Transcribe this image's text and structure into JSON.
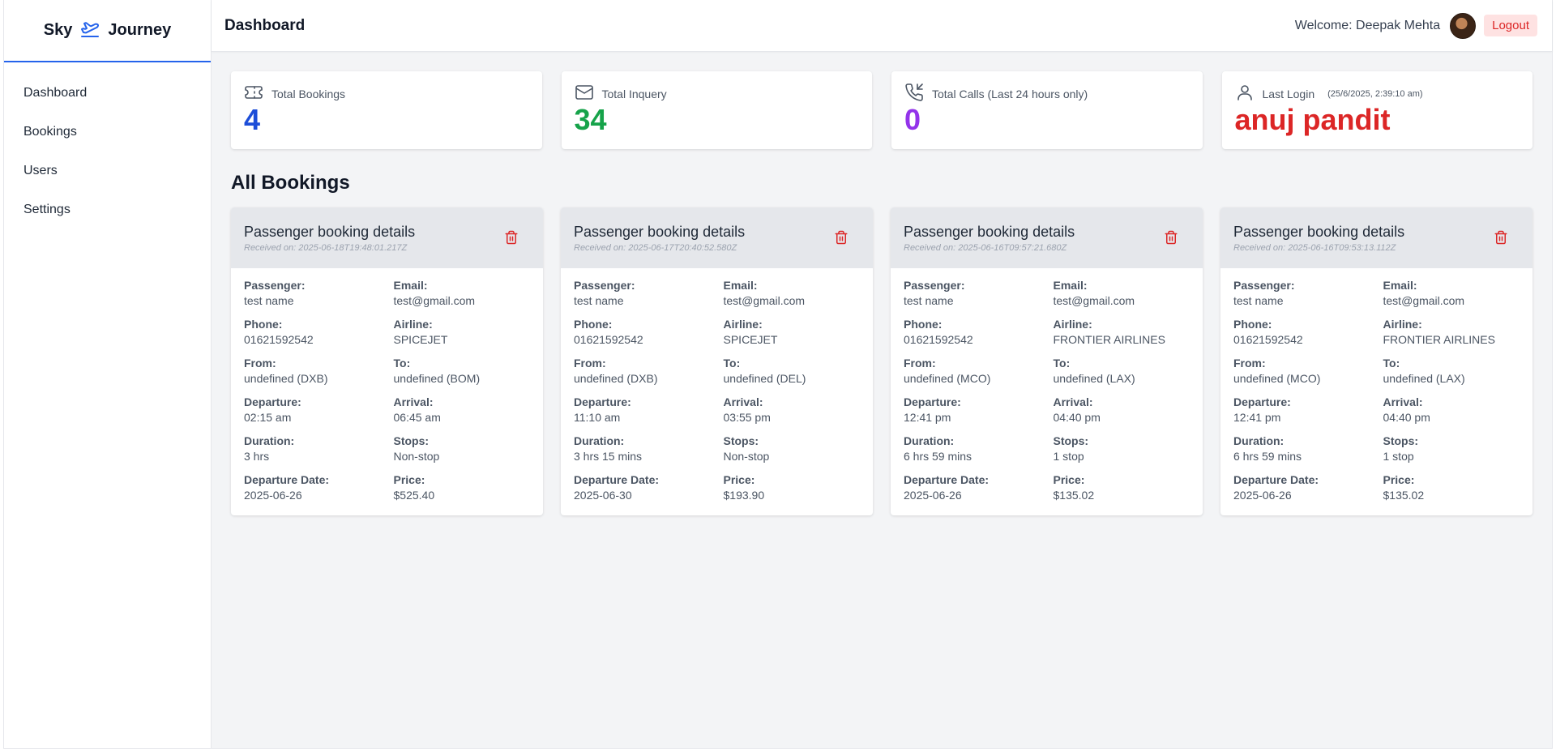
{
  "app": {
    "brand_left": "Sky",
    "brand_right": "Journey"
  },
  "sidebar": {
    "items": [
      {
        "label": "Dashboard"
      },
      {
        "label": "Bookings"
      },
      {
        "label": "Users"
      },
      {
        "label": "Settings"
      }
    ]
  },
  "header": {
    "title": "Dashboard",
    "welcome": "Welcome: Deepak Mehta",
    "logout": "Logout"
  },
  "stats": [
    {
      "label": "Total Bookings",
      "value": "4",
      "color": "#1d4ed8",
      "icon": "ticket-icon"
    },
    {
      "label": "Total Inquery",
      "value": "34",
      "color": "#16a34a",
      "icon": "mail-icon"
    },
    {
      "label": "Total Calls (Last 24 hours only)",
      "value": "0",
      "color": "#9333ea",
      "icon": "phone-incoming-icon"
    },
    {
      "label": "Last Login",
      "sub": "(25/6/2025, 2:39:10 am)",
      "value": "anuj pandit",
      "color": "#dc2626",
      "icon": "user-icon"
    }
  ],
  "bookings_title": "All Bookings",
  "bookings": [
    {
      "title": "Passenger booking details",
      "received": "Received on: 2025-06-18T19:48:01.217Z",
      "fields": [
        {
          "label": "Passenger:",
          "value": "test name"
        },
        {
          "label": "Email:",
          "value": "test@gmail.com"
        },
        {
          "label": "Phone:",
          "value": "01621592542"
        },
        {
          "label": "Airline:",
          "value": "SPICEJET"
        },
        {
          "label": "From:",
          "value": "undefined (DXB)"
        },
        {
          "label": "To:",
          "value": "undefined (BOM)"
        },
        {
          "label": "Departure:",
          "value": "02:15 am"
        },
        {
          "label": "Arrival:",
          "value": "06:45 am"
        },
        {
          "label": "Duration:",
          "value": "3 hrs"
        },
        {
          "label": "Stops:",
          "value": "Non-stop"
        },
        {
          "label": "Departure Date:",
          "value": "2025-06-26"
        },
        {
          "label": "Price:",
          "value": "$525.40"
        }
      ]
    },
    {
      "title": "Passenger booking details",
      "received": "Received on: 2025-06-17T20:40:52.580Z",
      "fields": [
        {
          "label": "Passenger:",
          "value": "test name"
        },
        {
          "label": "Email:",
          "value": "test@gmail.com"
        },
        {
          "label": "Phone:",
          "value": "01621592542"
        },
        {
          "label": "Airline:",
          "value": "SPICEJET"
        },
        {
          "label": "From:",
          "value": "undefined (DXB)"
        },
        {
          "label": "To:",
          "value": "undefined (DEL)"
        },
        {
          "label": "Departure:",
          "value": "11:10 am"
        },
        {
          "label": "Arrival:",
          "value": "03:55 pm"
        },
        {
          "label": "Duration:",
          "value": "3 hrs 15 mins"
        },
        {
          "label": "Stops:",
          "value": "Non-stop"
        },
        {
          "label": "Departure Date:",
          "value": "2025-06-30"
        },
        {
          "label": "Price:",
          "value": "$193.90"
        }
      ]
    },
    {
      "title": "Passenger booking details",
      "received": "Received on: 2025-06-16T09:57:21.680Z",
      "fields": [
        {
          "label": "Passenger:",
          "value": "test name"
        },
        {
          "label": "Email:",
          "value": "test@gmail.com"
        },
        {
          "label": "Phone:",
          "value": "01621592542"
        },
        {
          "label": "Airline:",
          "value": "FRONTIER AIRLINES"
        },
        {
          "label": "From:",
          "value": "undefined (MCO)"
        },
        {
          "label": "To:",
          "value": "undefined (LAX)"
        },
        {
          "label": "Departure:",
          "value": "12:41 pm"
        },
        {
          "label": "Arrival:",
          "value": "04:40 pm"
        },
        {
          "label": "Duration:",
          "value": "6 hrs 59 mins"
        },
        {
          "label": "Stops:",
          "value": "1 stop"
        },
        {
          "label": "Departure Date:",
          "value": "2025-06-26"
        },
        {
          "label": "Price:",
          "value": "$135.02"
        }
      ]
    },
    {
      "title": "Passenger booking details",
      "received": "Received on: 2025-06-16T09:53:13.112Z",
      "fields": [
        {
          "label": "Passenger:",
          "value": "test name"
        },
        {
          "label": "Email:",
          "value": "test@gmail.com"
        },
        {
          "label": "Phone:",
          "value": "01621592542"
        },
        {
          "label": "Airline:",
          "value": "FRONTIER AIRLINES"
        },
        {
          "label": "From:",
          "value": "undefined (MCO)"
        },
        {
          "label": "To:",
          "value": "undefined (LAX)"
        },
        {
          "label": "Departure:",
          "value": "12:41 pm"
        },
        {
          "label": "Arrival:",
          "value": "04:40 pm"
        },
        {
          "label": "Duration:",
          "value": "6 hrs 59 mins"
        },
        {
          "label": "Stops:",
          "value": "1 stop"
        },
        {
          "label": "Departure Date:",
          "value": "2025-06-26"
        },
        {
          "label": "Price:",
          "value": "$135.02"
        }
      ]
    }
  ],
  "colors": {
    "accent": "#2563eb",
    "danger": "#dc2626"
  }
}
